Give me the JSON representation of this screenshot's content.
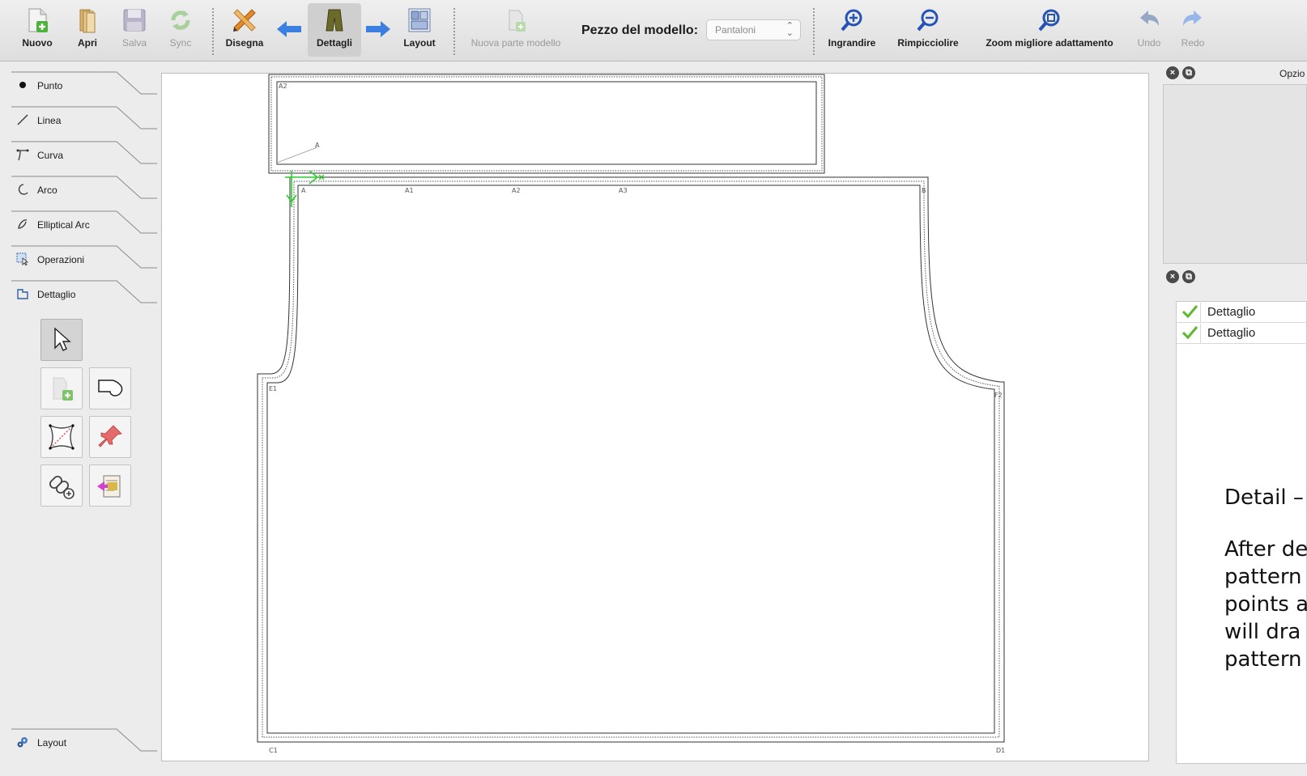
{
  "toolbar": {
    "buttons": [
      {
        "label": "Nuovo"
      },
      {
        "label": "Apri"
      },
      {
        "label": "Salva"
      },
      {
        "label": "Sync"
      },
      {
        "label": "Disegna"
      },
      {
        "label": "Dettagli"
      },
      {
        "label": "Layout"
      },
      {
        "label": "Nuova parte modello"
      },
      {
        "label": "Ingrandire"
      },
      {
        "label": "Rimpicciolire"
      },
      {
        "label": "Zoom migliore adattamento"
      },
      {
        "label": "Undo"
      },
      {
        "label": "Redo"
      }
    ],
    "piece_label": "Pezzo del modello:",
    "piece_value": "Pantaloni"
  },
  "tools": {
    "categories": [
      {
        "label": "Punto"
      },
      {
        "label": "Linea"
      },
      {
        "label": "Curva"
      },
      {
        "label": "Arco"
      },
      {
        "label": "Elliptical Arc"
      },
      {
        "label": "Operazioni"
      },
      {
        "label": "Dettaglio"
      }
    ],
    "bottom_category": {
      "label": "Layout"
    }
  },
  "canvas": {
    "points": [
      "A2",
      "A",
      "A",
      "A1",
      "A2",
      "A3",
      "B",
      "E1",
      "F2",
      "C1",
      "D1"
    ]
  },
  "right_panel": {
    "options_title": "Opzio",
    "details": [
      {
        "label": "Dettaglio",
        "checked": true
      },
      {
        "label": "Dettaglio",
        "checked": true
      }
    ],
    "help_title": "Detail –",
    "help_lines": [
      "After de",
      "pattern",
      "points a",
      "will dra",
      "pattern"
    ]
  },
  "colors": {
    "accent_blue": "#3b7fe0",
    "seam_green": "#2fcc2f",
    "check_green": "#5cb82e"
  }
}
